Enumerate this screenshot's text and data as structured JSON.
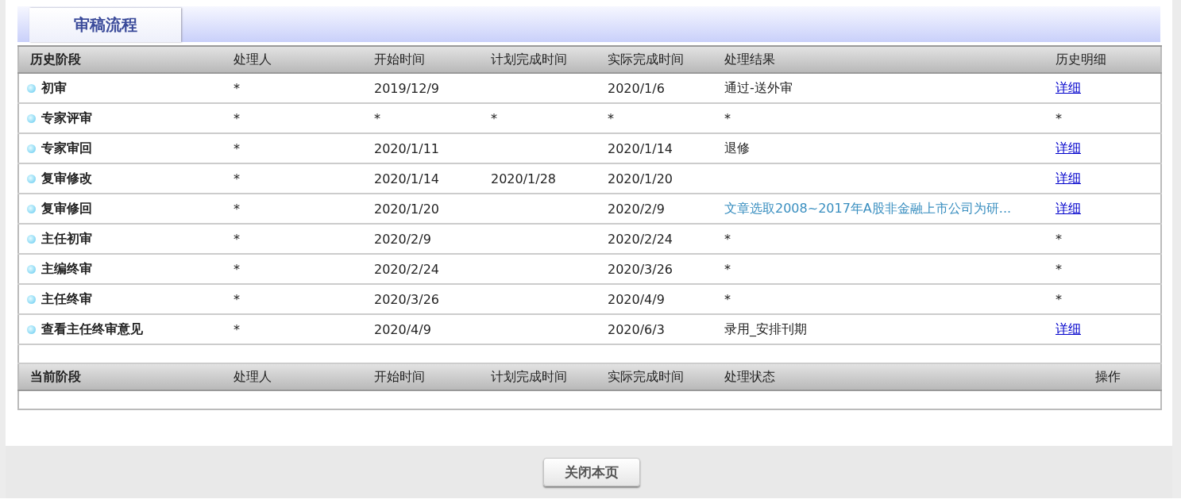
{
  "tab": {
    "label": "审稿流程",
    "selected": true
  },
  "history_table": {
    "columns": [
      "历史阶段",
      "处理人",
      "开始时间",
      "计划完成时间",
      "实际完成时间",
      "处理结果",
      "历史明细"
    ],
    "rows": [
      {
        "stage": "初审",
        "handler": "*",
        "start": "2019/12/9",
        "actual": "2020/1/6",
        "result": {
          "text": "通过-送外审",
          "kind": "text"
        },
        "detail": {
          "text": "详细",
          "kind": "link"
        }
      },
      {
        "stage": "专家评审",
        "handler": "*",
        "start": "*",
        "planned": "*",
        "actual": "*",
        "result": {
          "text": "*",
          "kind": "text"
        },
        "detail": {
          "text": "*",
          "kind": "text"
        }
      },
      {
        "stage": "专家审回",
        "handler": "*",
        "start": "2020/1/11",
        "actual": "2020/1/14",
        "result": {
          "text": "退修",
          "kind": "text"
        },
        "detail": {
          "text": "详细",
          "kind": "link"
        }
      },
      {
        "stage": "复审修改",
        "handler": "*",
        "start": "2020/1/14",
        "planned": "2020/1/28",
        "actual": "2020/1/20",
        "detail": {
          "text": "详细",
          "kind": "link"
        }
      },
      {
        "stage": "复审修回",
        "handler": "*",
        "start": "2020/1/20",
        "actual": "2020/2/9",
        "result": {
          "text": "文章选取2008~2017年A股非金融上市公司为研...",
          "kind": "link"
        },
        "detail": {
          "text": "详细",
          "kind": "link"
        }
      },
      {
        "stage": "主任初审",
        "handler": "*",
        "start": "2020/2/9",
        "actual": "2020/2/24",
        "result": {
          "text": "*",
          "kind": "text"
        },
        "detail": {
          "text": "*",
          "kind": "text"
        }
      },
      {
        "stage": "主编终审",
        "handler": "*",
        "start": "2020/2/24",
        "actual": "2020/3/26",
        "result": {
          "text": "*",
          "kind": "text"
        },
        "detail": {
          "text": "*",
          "kind": "text"
        }
      },
      {
        "stage": "主任终审",
        "handler": "*",
        "start": "2020/3/26",
        "actual": "2020/4/9",
        "result": {
          "text": "*",
          "kind": "text"
        },
        "detail": {
          "text": "*",
          "kind": "text"
        }
      },
      {
        "stage": "查看主任终审意见",
        "handler": "*",
        "start": "2020/4/9",
        "actual": "2020/6/3",
        "result": {
          "text": "录用_安排刊期",
          "kind": "text"
        },
        "detail": {
          "text": "详细",
          "kind": "link"
        }
      }
    ]
  },
  "current_table": {
    "columns": [
      "当前阶段",
      "处理人",
      "开始时间",
      "计划完成时间",
      "实际完成时间",
      "处理状态",
      "操作"
    ]
  },
  "close_button": "关闭本页"
}
